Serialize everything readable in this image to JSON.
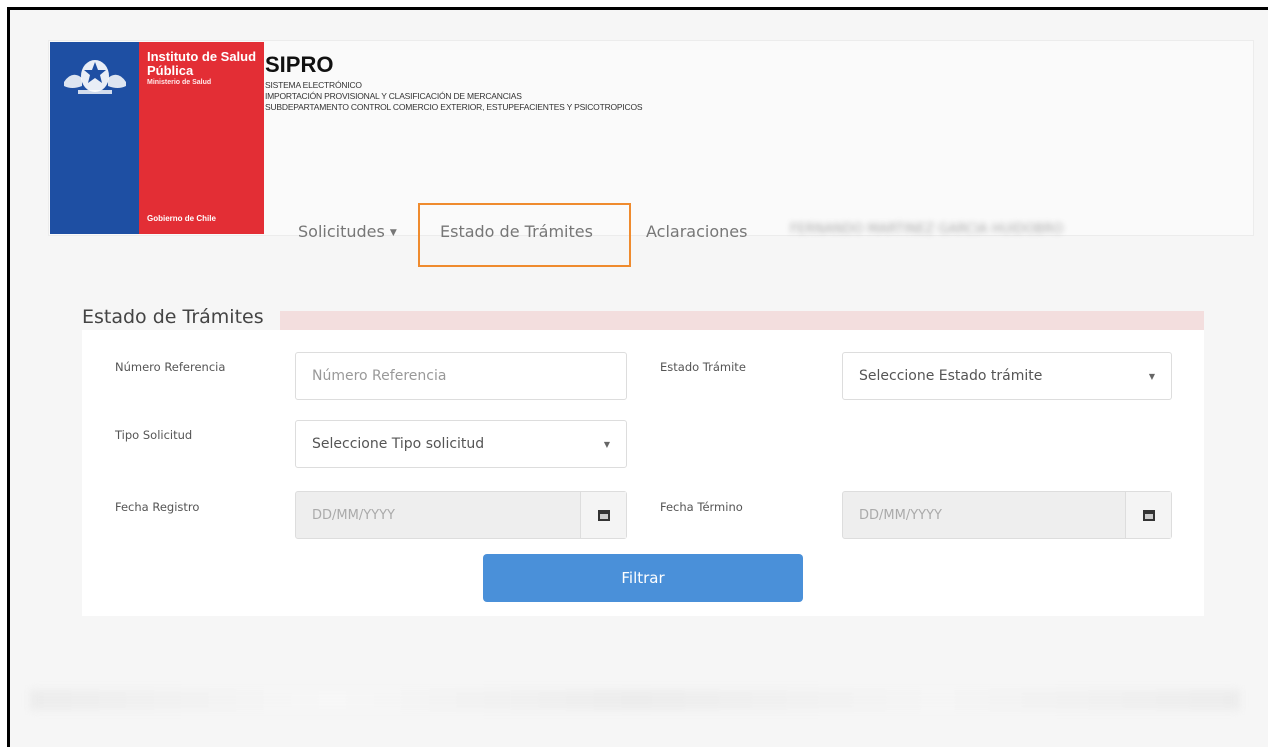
{
  "logo": {
    "title": "Instituto de Salud Pública",
    "subtitle": "Ministerio de Salud",
    "gov": "Gobierno de Chile"
  },
  "system": {
    "title": "SIPRO",
    "lines": [
      "SISTEMA ELECTRÓNICO",
      "IMPORTACIÓN PROVISIONAL Y CLASIFICACIÓN DE MERCANCIAS",
      "SUBDEPARTAMENTO CONTROL COMERCIO EXTERIOR, ESTUPEFACIENTES Y PSICOTROPICOS"
    ]
  },
  "nav": {
    "solicitudes": "Solicitudes",
    "estado": "Estado de Trámites",
    "aclaraciones": "Aclaraciones",
    "user": "FERNANDO MARTINEZ GARCIA HUIDOBRO"
  },
  "form": {
    "title": "Estado de Trámites",
    "numero_label": "Número Referencia",
    "numero_placeholder": "Número Referencia",
    "estado_label": "Estado Trámite",
    "estado_value": "Seleccione Estado trámite",
    "tipo_label": "Tipo Solicitud",
    "tipo_value": "Seleccione Tipo solicitud",
    "fecha_registro_label": "Fecha Registro",
    "fecha_registro_placeholder": "DD/MM/YYYY",
    "fecha_termino_label": "Fecha Término",
    "fecha_termino_placeholder": "DD/MM/YYYY",
    "filtrar": "Filtrar"
  }
}
